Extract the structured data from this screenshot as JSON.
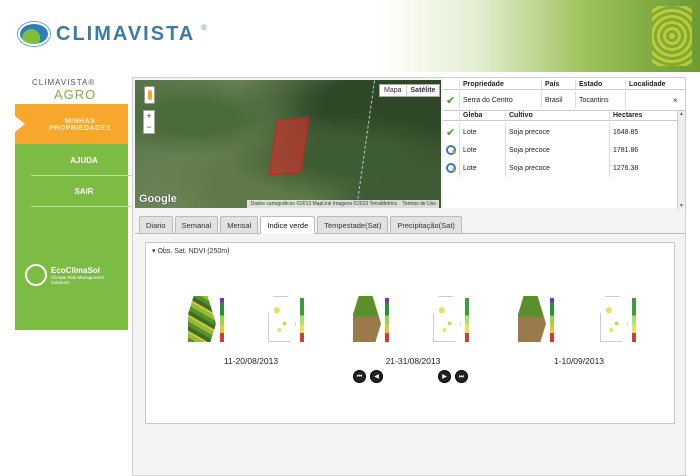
{
  "brand": {
    "name": "CLIMAVISTA",
    "reg": "®"
  },
  "agro": {
    "top": "CLIMAVISTA®",
    "main": "AGRO"
  },
  "nav": {
    "active": "MINHAS PROPRIEDADES",
    "items": [
      "AJUDA",
      "SAIR"
    ]
  },
  "partner": {
    "name": "EcoClimaSol",
    "tagline": "Climate Risk Management Solutions"
  },
  "map": {
    "type_options": [
      "Mapa",
      "Satélite"
    ],
    "selected_type": "Satélite",
    "zoom_in": "+",
    "zoom_out": "−",
    "provider": "Google",
    "attribution": "Dados cartográficos ©2013 MapLink Imagens ©2013 TerraMetrics",
    "terms": "Termos de Uso"
  },
  "property_table": {
    "headers": [
      "Propriedade",
      "País",
      "Estado",
      "Localidade"
    ],
    "row": {
      "propriedade": "Serra do Centro",
      "pais": "Brasil",
      "estado": "Tocantins",
      "localidade": ""
    },
    "close": "×"
  },
  "gleba_table": {
    "headers": [
      "Gleba",
      "Cultivo",
      "Hectares"
    ],
    "rows": [
      {
        "gleba": "Lote",
        "cultivo": "Soja precoce",
        "hectares": "1648.85",
        "icon": "check-icon"
      },
      {
        "gleba": "Lote",
        "cultivo": "Soja precoce",
        "hectares": "1781.86",
        "icon": "search-icon"
      },
      {
        "gleba": "Lote",
        "cultivo": "Soja precoce",
        "hectares": "1276.38",
        "icon": "search-icon"
      }
    ]
  },
  "tabs": [
    "Diario",
    "Semanal",
    "Mensal",
    "Indice verde",
    "Tempestade(Sat)",
    "Precipitação(Sat)"
  ],
  "active_tab": "Indice verde",
  "ndvi": {
    "section_title": "Obs. Sat. NDVI (250m)",
    "periods": [
      "11-20/08/2013",
      "21-31/08/2013",
      "1-10/09/2013"
    ]
  },
  "controls": [
    "first-icon",
    "prev-icon",
    "next-icon",
    "last-icon"
  ],
  "colors": {
    "sidebar": "#7cbb44",
    "active_nav": "#f7a72b",
    "brand_blue": "#3a7ca8",
    "polygon": "#e02828"
  }
}
